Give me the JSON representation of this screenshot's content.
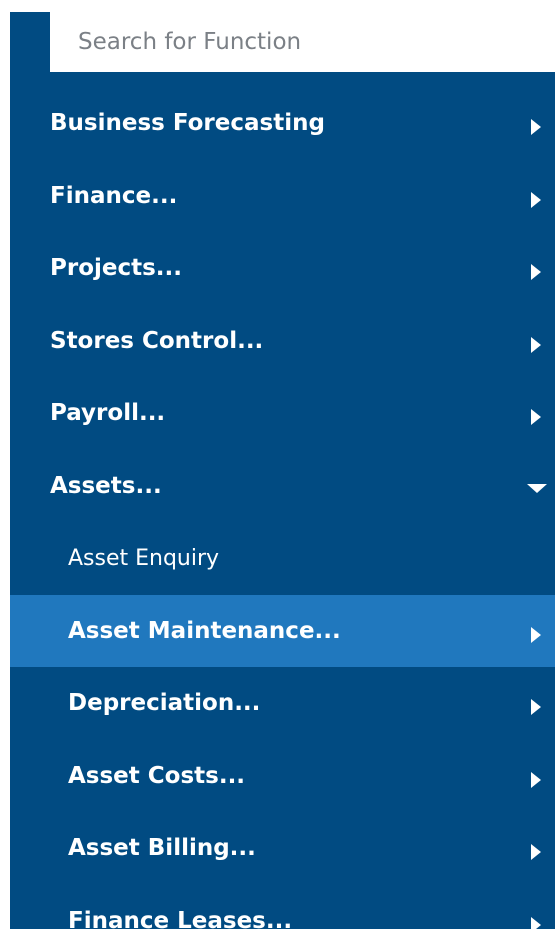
{
  "search": {
    "placeholder": "Search for Function"
  },
  "menu": {
    "items": [
      {
        "label": "Business Forecasting",
        "icon": "chevron-right-icon"
      },
      {
        "label": "Finance...",
        "icon": "chevron-right-icon"
      },
      {
        "label": "Projects...",
        "icon": "chevron-right-icon"
      },
      {
        "label": "Stores Control...",
        "icon": "chevron-right-icon"
      },
      {
        "label": "Payroll...",
        "icon": "chevron-right-icon"
      },
      {
        "label": "Assets...",
        "icon": "chevron-down-icon",
        "expanded": true
      }
    ],
    "assets_children": [
      {
        "label": "Asset Enquiry"
      },
      {
        "label": "Asset Maintenance...",
        "icon": "chevron-right-icon",
        "selected": true
      },
      {
        "label": "Depreciation...",
        "icon": "chevron-right-icon"
      },
      {
        "label": "Asset Costs...",
        "icon": "chevron-right-icon"
      },
      {
        "label": "Asset Billing...",
        "icon": "chevron-right-icon"
      },
      {
        "label": "Finance Leases...",
        "icon": "chevron-right-icon"
      }
    ]
  },
  "colors": {
    "panel_background": "#014b82",
    "selected_background": "#2078be",
    "text": "#ffffff",
    "placeholder_text": "#7b8086"
  }
}
